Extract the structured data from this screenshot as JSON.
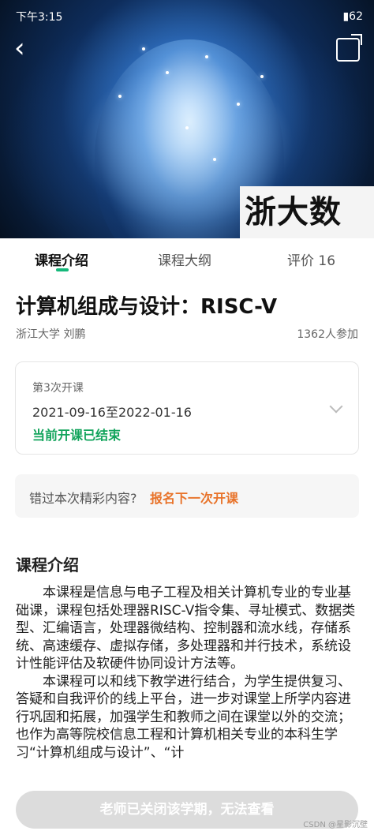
{
  "status_bar": {
    "time": "下午3:15",
    "battery": "62"
  },
  "hero": {
    "logo_text": "浙大数"
  },
  "tabs": [
    {
      "label": "课程介绍",
      "active": true
    },
    {
      "label": "课程大纲",
      "active": false
    },
    {
      "label": "评价 16",
      "active": false
    }
  ],
  "course": {
    "title": "计算机组成与设计：RISC-V",
    "meta": "浙江大学  刘鹏",
    "participants": "1362人参加"
  },
  "session": {
    "label": "第3次开课",
    "dates": "2021-09-16至2022-01-16",
    "status": "当前开课已结束"
  },
  "missed": {
    "prompt": "错过本次精彩内容?",
    "link": "报名下一次开课"
  },
  "intro": {
    "heading": "课程介绍",
    "paragraphs": [
      "本课程是信息与电子工程及相关计算机专业的专业基础课，课程包括处理器RISC-V指令集、寻址模式、数据类型、汇编语言，处理器微结构、控制器和流水线，存储系统、高速缓存、虚拟存储，多处理器和并行技术，系统设计性能评估及软硬件协同设计方法等。",
      "本课程可以和线下教学进行结合，为学生提供复习、答疑和自我评价的线上平台，进一步对课堂上所学内容进行巩固和拓展，加强学生和教师之间在课堂以外的交流；也作为高等院校信息工程和计算机相关专业的本科生学习“计算机组成与设计”、“计"
    ]
  },
  "bottom_button": "老师已关闭该学期，无法查看",
  "watermark": "CSDN @星影沉壁",
  "colors": {
    "accent": "#15b87a",
    "status_green": "#12a45c",
    "link_orange": "#e8732a"
  }
}
